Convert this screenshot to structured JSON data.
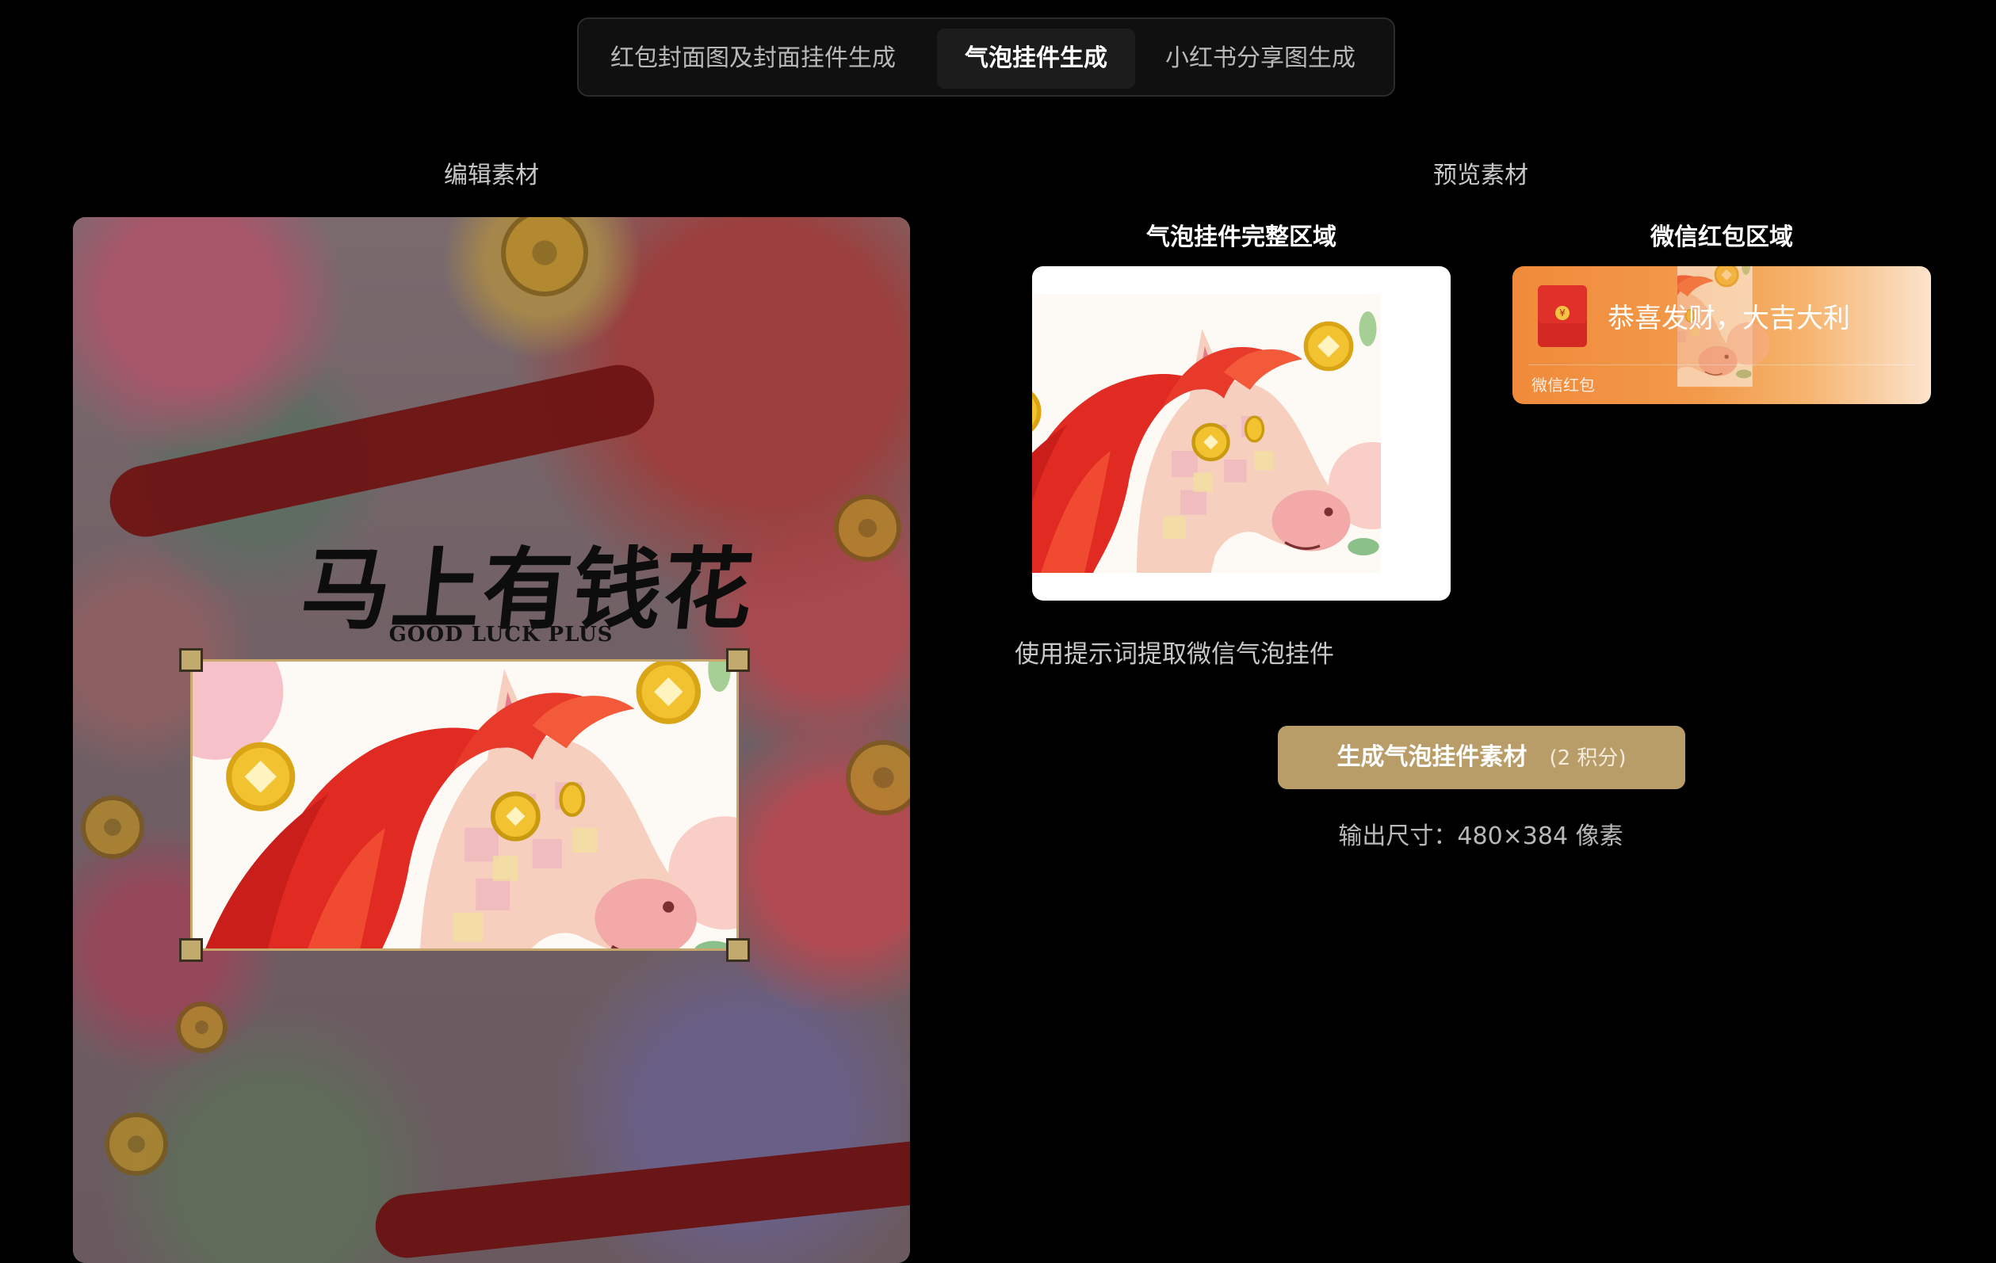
{
  "tabs": [
    {
      "label": "红包封面图及封面挂件生成",
      "active": false
    },
    {
      "label": "气泡挂件生成",
      "active": true
    },
    {
      "label": "小红书分享图生成",
      "active": false
    }
  ],
  "editor": {
    "section_title": "编辑素材",
    "artwork_title": "马上有钱花",
    "artwork_subtitle": "GOOD LUCK PLUS"
  },
  "preview": {
    "section_title": "预览素材",
    "bubble_area_label": "气泡挂件完整区域",
    "redpacket_area_label": "微信红包区域",
    "redpacket_greeting": "恭喜发财，大吉大利",
    "redpacket_footer": "微信红包"
  },
  "hint_text": "使用提示词提取微信气泡挂件",
  "generate_button": {
    "label": "生成气泡挂件素材",
    "cost": "(2 积分)"
  },
  "output_size": "输出尺寸：480×384 像素",
  "colors": {
    "accent": "#b89d68",
    "background": "#000000",
    "redpacket_orange": "#f08a3a"
  }
}
